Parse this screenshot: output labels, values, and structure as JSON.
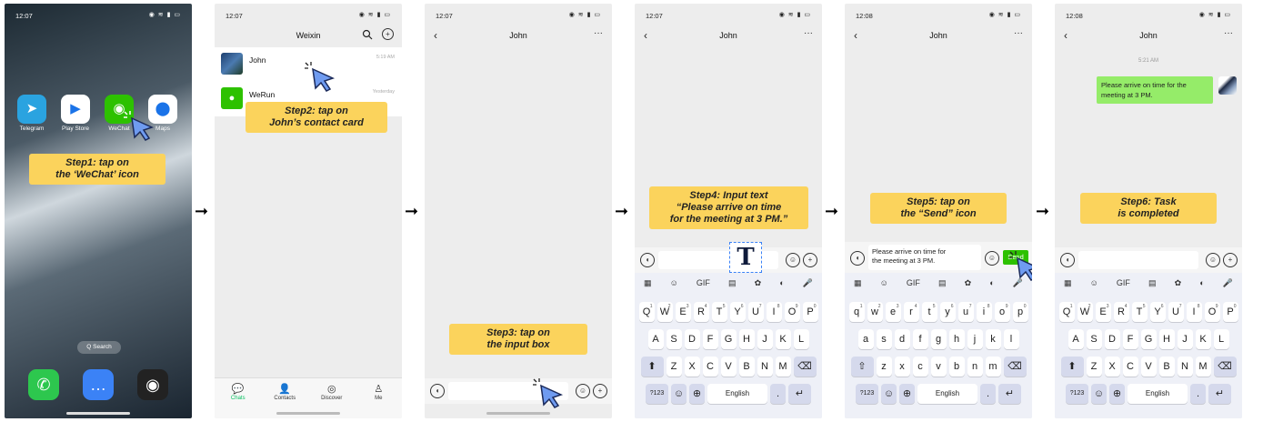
{
  "home": {
    "time": "12:07",
    "status_icons": "◉ ≋ ▮ ▭",
    "apps": [
      {
        "label": "Telegram",
        "color": "#2aa3e0",
        "glyph": "➤"
      },
      {
        "label": "Play Store",
        "color": "#ffffff",
        "glyph": "▶"
      },
      {
        "label": "WeChat",
        "color": "#2dc100",
        "glyph": "◉"
      },
      {
        "label": "Maps",
        "color": "#ffffff",
        "glyph": "⬤"
      }
    ],
    "search_label": "Q  Search",
    "dock": [
      {
        "name": "phone-icon",
        "color": "#2dc74e",
        "glyph": "✆"
      },
      {
        "name": "messages-icon",
        "color": "#3b82f6",
        "glyph": "…"
      },
      {
        "name": "camera-icon",
        "color": "#222222",
        "glyph": "◉"
      }
    ],
    "callout": [
      "Step1: tap on",
      "the ‘WeChat’ icon"
    ]
  },
  "chatlist": {
    "time": "12:07",
    "title": "Weixin",
    "rows": [
      {
        "name": "John",
        "time": "5:19 AM"
      },
      {
        "name": "WeRun",
        "time": "Yesterday"
      }
    ],
    "callout": [
      "Step2: tap on",
      "John’s contact card"
    ],
    "tabs": [
      {
        "label": "Chats",
        "glyph": "💬",
        "active": true
      },
      {
        "label": "Contacts",
        "glyph": "👤"
      },
      {
        "label": "Discover",
        "glyph": "◎"
      },
      {
        "label": "Me",
        "glyph": "♙"
      }
    ]
  },
  "chat3": {
    "time": "12:07",
    "title": "John",
    "callout": [
      "Step3: tap on",
      "the input box"
    ]
  },
  "chat4": {
    "time": "12:07",
    "title": "John",
    "callout": [
      "Step4: Input text",
      "“Please arrive on time",
      "for the meeting at 3 PM.”"
    ],
    "text_icon": "T"
  },
  "chat5": {
    "time": "12:08",
    "title": "John",
    "callout": [
      "Step5: tap on",
      "the “Send” icon"
    ],
    "input_text": [
      "Please arrive on time for",
      "the meeting at 3 PM."
    ],
    "send_label": "Send"
  },
  "chat6": {
    "time": "12:08",
    "title": "John",
    "timestamp": "5:21 AM",
    "message": [
      "Please arrive on time for the",
      "meeting at 3 PM."
    ],
    "callout": [
      "Step6: Task",
      "is completed"
    ]
  },
  "keyboard": {
    "tools": [
      "▦",
      "☺",
      "GIF",
      "▤",
      "✿",
      "◐",
      "🎤"
    ],
    "row1_upper": [
      "Q",
      "W",
      "E",
      "R",
      "T",
      "Y",
      "U",
      "I",
      "O",
      "P"
    ],
    "row1_lower": [
      "q",
      "w",
      "e",
      "r",
      "t",
      "y",
      "u",
      "i",
      "o",
      "p"
    ],
    "row1_nums": [
      "1",
      "2",
      "3",
      "4",
      "5",
      "6",
      "7",
      "8",
      "9",
      "0"
    ],
    "row2_upper": [
      "A",
      "S",
      "D",
      "F",
      "G",
      "H",
      "J",
      "K",
      "L"
    ],
    "row2_lower": [
      "a",
      "s",
      "d",
      "f",
      "g",
      "h",
      "j",
      "k",
      "l"
    ],
    "row3_upper": [
      "Z",
      "X",
      "C",
      "V",
      "B",
      "N",
      "M"
    ],
    "row3_lower": [
      "z",
      "x",
      "c",
      "v",
      "b",
      "n",
      "m"
    ],
    "shift": "⬆",
    "shift_outline": "⇧",
    "backspace": "⌫",
    "numkey": "?123",
    "emoji": "☺",
    "globe": "⊕",
    "space": "English",
    "period": ".",
    "enter": "↵"
  },
  "arrows": "➞"
}
